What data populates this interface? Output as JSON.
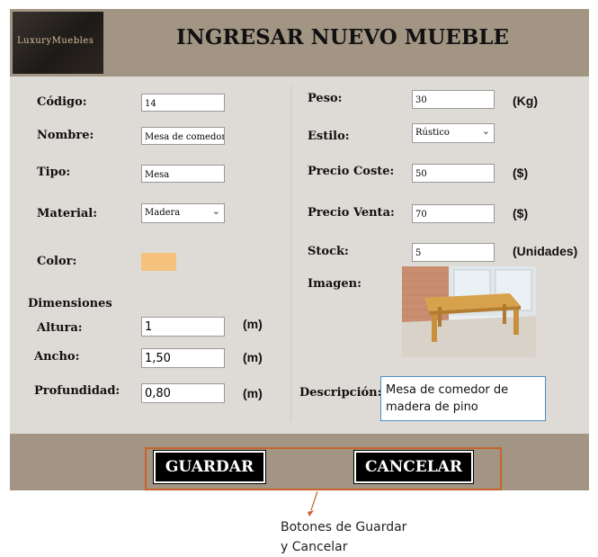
{
  "header": {
    "logo_text": "LuxuryMuebles",
    "title": "INGRESAR NUEVO MUEBLE"
  },
  "left": {
    "codigo": {
      "label": "Código:",
      "value": "14"
    },
    "nombre": {
      "label": "Nombre:",
      "value": "Mesa de comedor"
    },
    "tipo": {
      "label": "Tipo:",
      "value": "Mesa"
    },
    "material": {
      "label": "Material:",
      "value": "Madera"
    },
    "color": {
      "label": "Color:",
      "swatch": "#f5c27e"
    },
    "dimensiones": {
      "heading": "Dimensiones",
      "altura": {
        "label": "Altura:",
        "value": "1",
        "unit": "(m)"
      },
      "ancho": {
        "label": "Ancho:",
        "value": "1,50",
        "unit": "(m)"
      },
      "profundidad": {
        "label": "Profundidad:",
        "value": "0,80",
        "unit": "(m)"
      }
    }
  },
  "right": {
    "peso": {
      "label": "Peso:",
      "value": "30",
      "unit": "(Kg)"
    },
    "estilo": {
      "label": "Estilo:",
      "value": "Rústico"
    },
    "precio_coste": {
      "label": "Precio Coste:",
      "value": "50",
      "unit": "($)"
    },
    "precio_venta": {
      "label": "Precio Venta:",
      "value": "70",
      "unit": "($)"
    },
    "stock": {
      "label": "Stock:",
      "value": "5",
      "unit": "(Unidades)"
    },
    "imagen": {
      "label": "Imagen:"
    },
    "descripcion": {
      "label": "Descripción:",
      "value": "Mesa de comedor de madera de pino"
    }
  },
  "footer": {
    "save_label": "GUARDAR",
    "cancel_label": "CANCELAR"
  },
  "annotation": {
    "line1": "Botones de Guardar",
    "line2": "y Cancelar"
  },
  "colors": {
    "panel": "#dedad5",
    "bar": "#a29583",
    "highlight": "#c8632a",
    "swatch": "#f5c27e"
  }
}
